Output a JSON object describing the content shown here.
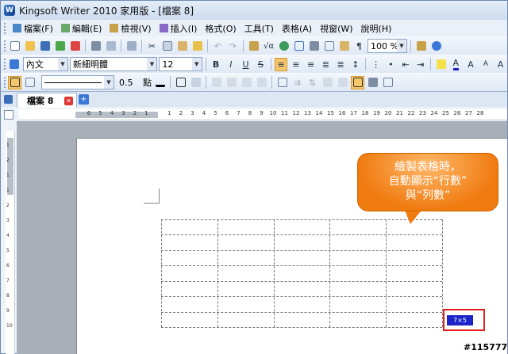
{
  "window": {
    "title": "Kingsoft Writer 2010 家用版 - [檔案 8]"
  },
  "menubar": {
    "items": [
      {
        "label": "檔案(F)"
      },
      {
        "label": "編輯(E)"
      },
      {
        "label": "檢視(V)"
      },
      {
        "label": "插入(I)"
      },
      {
        "label": "格式(O)"
      },
      {
        "label": "工具(T)"
      },
      {
        "label": "表格(A)"
      },
      {
        "label": "視窗(W)"
      },
      {
        "label": "說明(H)"
      }
    ]
  },
  "toolbar_standard": {
    "zoom": "100 %"
  },
  "toolbar_format": {
    "style": "內文",
    "font": "新細明體",
    "size": "12"
  },
  "toolbar_table": {
    "line_width": "0.5",
    "line_unit": "點"
  },
  "document_tabs": [
    {
      "label": "檔案 8"
    }
  ],
  "ruler": {
    "left_numbers": [
      "6",
      "5",
      "4",
      "3",
      "2",
      "1"
    ],
    "right_numbers": [
      "1",
      "2",
      "3",
      "4",
      "5",
      "6",
      "7",
      "8",
      "9",
      "10",
      "11",
      "12",
      "13",
      "14",
      "15",
      "16",
      "17",
      "18",
      "19",
      "20",
      "21",
      "22",
      "23",
      "24",
      "25",
      "26",
      "27",
      "28"
    ],
    "vertical_numbers": [
      "1",
      "2",
      "1",
      "1",
      "2",
      "3",
      "4",
      "5",
      "6",
      "7",
      "8",
      "9",
      "10"
    ]
  },
  "table": {
    "rows": 7,
    "columns": 5
  },
  "callout": {
    "line1": "繪製表格時，",
    "line2": "自動顯示“行數”",
    "line3": "與“列數”"
  },
  "row_col_indicator": "7×5",
  "watermark": "#115777"
}
